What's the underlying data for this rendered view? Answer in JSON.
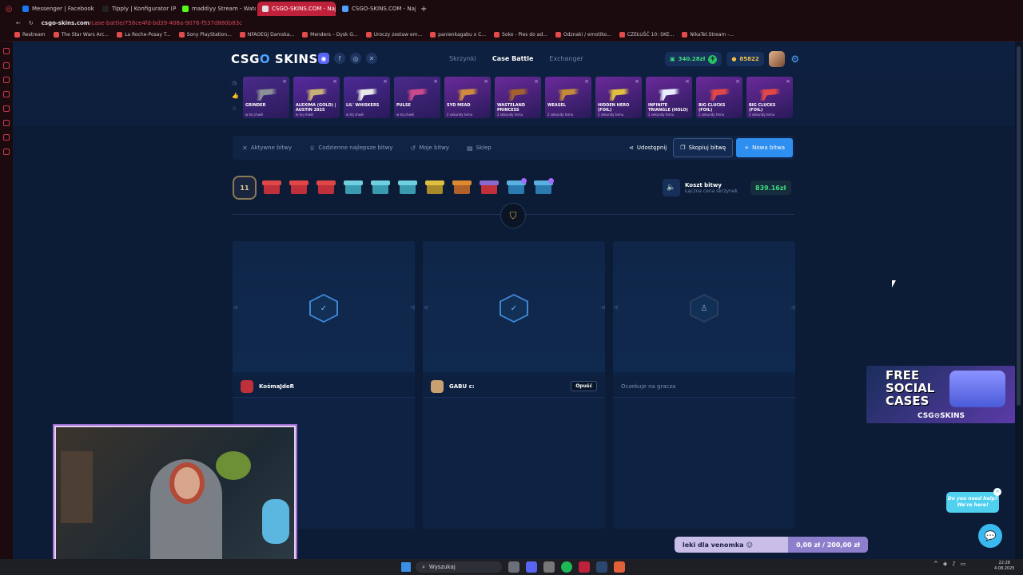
{
  "browser": {
    "tabs": [
      {
        "label": "Messenger | Facebook",
        "color": "#1877f2"
      },
      {
        "label": "Tipply | Konfigurator (Po",
        "color": "#222222"
      },
      {
        "label": "maddiyy Stream - Watch",
        "color": "#53fc18"
      },
      {
        "label": "CSGO-SKINS.COM - Naj",
        "color": "#e0e0e0",
        "active": true
      },
      {
        "label": "CSGO-SKINS.COM - Naj",
        "color": "#4ea1ff"
      }
    ],
    "new_tab": "+",
    "url_host": "csgo-skins.com",
    "url_path": "/case-battle/758ce4fd-bd39-408a-9076-f537d880b83c",
    "bookmarks": [
      "Restream",
      "The Star Wars Arc...",
      "La Roche-Posay T...",
      "Sony PlayStation...",
      "NFAOEGJ Damska...",
      "Menders – Dysk G...",
      "Uroczy zestaw em...",
      "panienkagabu x C...",
      "Soko - Pies do ad...",
      "Odznaki / emotiko...",
      "CZEŁUŚĆ 10: SKE...",
      "NikaTel.Stream -..."
    ]
  },
  "header": {
    "logo_left": "CSG",
    "logo_o": "O",
    "logo_right": " SKINS",
    "nav": [
      {
        "label": "Skrzynki",
        "active": false
      },
      {
        "label": "Case Battle",
        "active": true
      },
      {
        "label": "Exchanger",
        "active": false
      }
    ],
    "balance": "340.28zł",
    "coins": "85822"
  },
  "drops": [
    {
      "name": "GRINDER",
      "sub": "w tej chwili",
      "bg": "#4a2a8a",
      "art": "#8a9096"
    },
    {
      "name": "ALEXIMA (GOLD) | AUSTIN 2025",
      "sub": "w tej chwili",
      "bg": "#5a2aa0",
      "art": "#c9b077"
    },
    {
      "name": "LIL' WHISKERS",
      "sub": "w tej chwili",
      "bg": "#4d2a96",
      "art": "#e8e8e8"
    },
    {
      "name": "PULSE",
      "sub": "w tej chwili",
      "bg": "#4a2a8a",
      "art": "#c94a8a"
    },
    {
      "name": "SYD MEAD",
      "sub": "2 sekundy temu",
      "bg": "#6a2a9a",
      "art": "#d08a40"
    },
    {
      "name": "WASTELAND PRINCESS",
      "sub": "2 sekundy temu",
      "bg": "#6a2a9a",
      "art": "#a4612f"
    },
    {
      "name": "WEASEL",
      "sub": "2 sekundy temu",
      "bg": "#6a2a9a",
      "art": "#c48a3a"
    },
    {
      "name": "HIDDEN HERO (FOIL)",
      "sub": "2 sekundy temu",
      "bg": "#6a2a9a",
      "art": "#e0c040"
    },
    {
      "name": "INFINITE TRIANGLE (HOLO)",
      "sub": "2 sekundy temu",
      "bg": "#6a2a9a",
      "art": "#e8f0ff"
    },
    {
      "name": "BIG CLUCKS (FOIL)",
      "sub": "2 sekundy temu",
      "bg": "#6a2a9a",
      "art": "#e04848"
    },
    {
      "name": "BIG CLUCKS (FOIL)",
      "sub": "2 sekundy temu",
      "bg": "#6a2a9a",
      "art": "#e04848"
    }
  ],
  "toolbar": {
    "active_battles": "Aktywne bitwy",
    "daily_best": "Codzienne najlepsze bitwy",
    "my_battles": "Moje bitwy",
    "shop": "Sklep",
    "share": "Udostępnij",
    "copy": "Skopiuj bitwę",
    "new_battle": "Nowa bitwa"
  },
  "battle": {
    "rounds": "11",
    "cases": [
      {
        "lid": "#e04848",
        "box": "#c0303a"
      },
      {
        "lid": "#e04848",
        "box": "#c0303a"
      },
      {
        "lid": "#e04848",
        "box": "#c0303a"
      },
      {
        "lid": "#6fd0e0",
        "box": "#3a9ab0"
      },
      {
        "lid": "#6fd0e0",
        "box": "#3a9ab0"
      },
      {
        "lid": "#6fd0e0",
        "box": "#3a9ab0"
      },
      {
        "lid": "#e0c040",
        "box": "#a88a2a"
      },
      {
        "lid": "#e08a30",
        "box": "#b0602a"
      },
      {
        "lid": "#8a6ad0",
        "box": "#c0303a"
      },
      {
        "lid": "#5ab0e0",
        "box": "#2a7ab0",
        "badge": true
      },
      {
        "lid": "#5ab0e0",
        "box": "#2a7ab0",
        "badge": true
      }
    ],
    "cost_label": "Koszt bitwy",
    "cost_sub": "Łączna cena skrzynek",
    "cost": "839.16zł"
  },
  "slots": [
    {
      "player": "KośmaJdeR",
      "status_icon": "✓",
      "avatar": "#c0303a",
      "leave": ""
    },
    {
      "player": "GABU c:",
      "status_icon": "✓",
      "avatar": "#c9a070",
      "leave": "Opuść"
    },
    {
      "player": "Oczekuje na gracza",
      "status_icon": "♙",
      "avatar": "",
      "leave": ""
    }
  ],
  "ad": {
    "line1": "FREE SOCIAL CASES",
    "brand": "CSG⊙SKINS"
  },
  "help": {
    "line1": "Do you need help?",
    "line2": "We're here!"
  },
  "bonus": {
    "label": "leki dla venomka",
    "value": "0,00 zł / 200,00 zł"
  },
  "taskbar": {
    "search": "Wyszukaj",
    "time": "22:28",
    "date": "4.08.2025"
  }
}
